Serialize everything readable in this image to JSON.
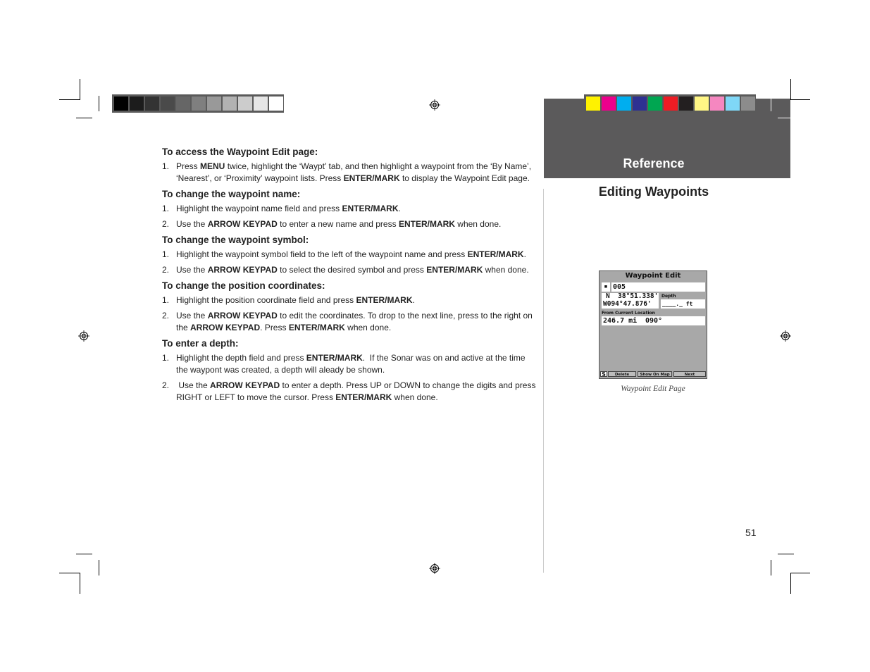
{
  "header": {
    "section": "Reference",
    "title": "Editing Waypoints",
    "grayscale_swatches": [
      "#000000",
      "#1c1c1c",
      "#333333",
      "#4a4a4a",
      "#666666",
      "#7f7f7f",
      "#999999",
      "#b2b2b2",
      "#cccccc",
      "#e6e6e6",
      "#ffffff"
    ],
    "color_swatches": [
      "#fff200",
      "#ec008c",
      "#00aeef",
      "#2e3192",
      "#00a651",
      "#ed1c24",
      "#231f20",
      "#fff685",
      "#f587c0",
      "#7fd7f7",
      "#8c8c8c"
    ]
  },
  "instructions": [
    {
      "heading": "To access the Waypoint Edit page:",
      "steps": [
        {
          "num": "1.",
          "html": "Press <b>MENU</b> twice, highlight the ‘Waypt’ tab, and then highlight a waypoint from the ‘By Name’, ‘Nearest’, or ‘Proximity’ waypoint lists. Press <b>ENTER/MARK</b> to display the Waypoint Edit page."
        }
      ]
    },
    {
      "heading": "To change the waypoint name:",
      "steps": [
        {
          "num": "1.",
          "html": "Highlight the waypoint name field and press <b>ENTER/MARK</b>."
        },
        {
          "num": "2.",
          "html": "Use the <b>ARROW KEYPAD</b> to enter a new name and press <b>ENTER/MARK</b> when done."
        }
      ]
    },
    {
      "heading": "To change the waypoint symbol:",
      "steps": [
        {
          "num": "1.",
          "html": "Highlight the waypoint symbol field to the left of the waypoint name and press <b>ENTER/MARK</b>."
        },
        {
          "num": "2.",
          "html": "Use the <b>ARROW KEYPAD</b> to select the desired symbol and press <b>ENTER/MARK</b> when done."
        }
      ]
    },
    {
      "heading": "To change the position coordinates:",
      "steps": [
        {
          "num": "1.",
          "html": "Highlight the position coordinate field and press <b>ENTER/MARK</b>."
        },
        {
          "num": "2.",
          "html": "Use the <b>ARROW KEYPAD</b> to edit the coordinates. To drop to the next line, press to the right on the <b>ARROW KEYPAD</b>. Press <b>ENTER/MARK</b> when done."
        }
      ]
    },
    {
      "heading": "To enter a depth:",
      "steps": [
        {
          "num": "1.",
          "html": "Highlight the depth field and press <b>ENTER/MARK</b>.&nbsp; If the Sonar was on and active at the time the waypont was created, a depth will aleady be shown."
        },
        {
          "num": "2.",
          "html": "&nbsp;Use the <b>ARROW KEYPAD</b> to enter a depth. Press UP or DOWN to change the digits and press RIGHT or LEFT to move the cursor. Press <b>ENTER/MARK</b> when done."
        }
      ]
    }
  ],
  "screen": {
    "title": "Waypoint Edit",
    "symbol": "▪",
    "name": "005",
    "lat": "N  38°51.338'",
    "lon": "W094°47.876'",
    "depth_label": "Depth",
    "depth_value": "____._ ft",
    "from_label": "From Current Location",
    "distance": "246.7 mi",
    "bearing": "090°",
    "soft_key": "S",
    "buttons": [
      "Delete",
      "Show On Map",
      "Next"
    ]
  },
  "caption": "Waypoint Edit Page",
  "page_number": "51"
}
